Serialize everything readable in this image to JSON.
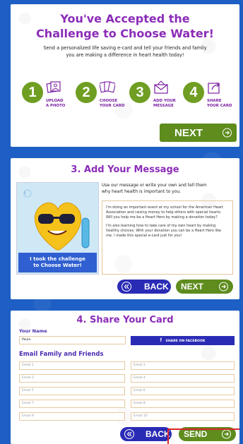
{
  "panel1": {
    "title_line1": "You've Accepted the",
    "title_line2": "Challenge to Choose Water!",
    "desc_line1": "Send a personalized life saving e-card and tell your friends and family",
    "desc_line2": "you are making a difference in heart health today!",
    "steps": [
      {
        "num": "1",
        "line1": "UPLOAD",
        "line2": "A PHOTO",
        "icon": "photo-icon"
      },
      {
        "num": "2",
        "line1": "CHOOSE",
        "line2": "YOUR CARD",
        "icon": "cards-icon"
      },
      {
        "num": "3",
        "line1": "ADD YOUR",
        "line2": "MESSAGE",
        "icon": "envelope-icon"
      },
      {
        "num": "4",
        "line1": "SHARE",
        "line2": "YOUR CARD",
        "icon": "share-icon"
      }
    ],
    "next_label": "NEXT",
    "accent": "#6f9e22"
  },
  "panel2": {
    "title": "3. Add Your Message",
    "intro_line1": "Use our message or write your own and tell them",
    "intro_line2": "why heart health is important to you.",
    "card_caption_line1": "I took the challenge",
    "card_caption_line2": "to Choose Water!",
    "message_p1": "I'm doing an important event at my school for the American Heart Association and raising money to help others with special hearts. Will you help me be a Heart Hero by making a donation today?",
    "message_p2": "I'm also learning how to take care of my own heart by making healthy choices. With your donation you can be a Heart Hero like me. I made this special e-card just for you!",
    "back_label": "BACK",
    "next_label": "NEXT"
  },
  "panel3": {
    "title": "4. Share Your Card",
    "your_name_label": "Your Name",
    "your_name_value": "Paula",
    "facebook_label": "SHARE ON FACEBOOK",
    "facebook_glyph": "f",
    "email_section_label": "Email Family and Friends",
    "emails_left": [
      "Email 1",
      "Email 3",
      "Email 5",
      "Email 7",
      "Email 9"
    ],
    "emails_right": [
      "Email 2",
      "Email 4",
      "Email 6",
      "Email 8",
      "Email 10"
    ],
    "back_label": "BACK",
    "send_label": "SEND"
  }
}
